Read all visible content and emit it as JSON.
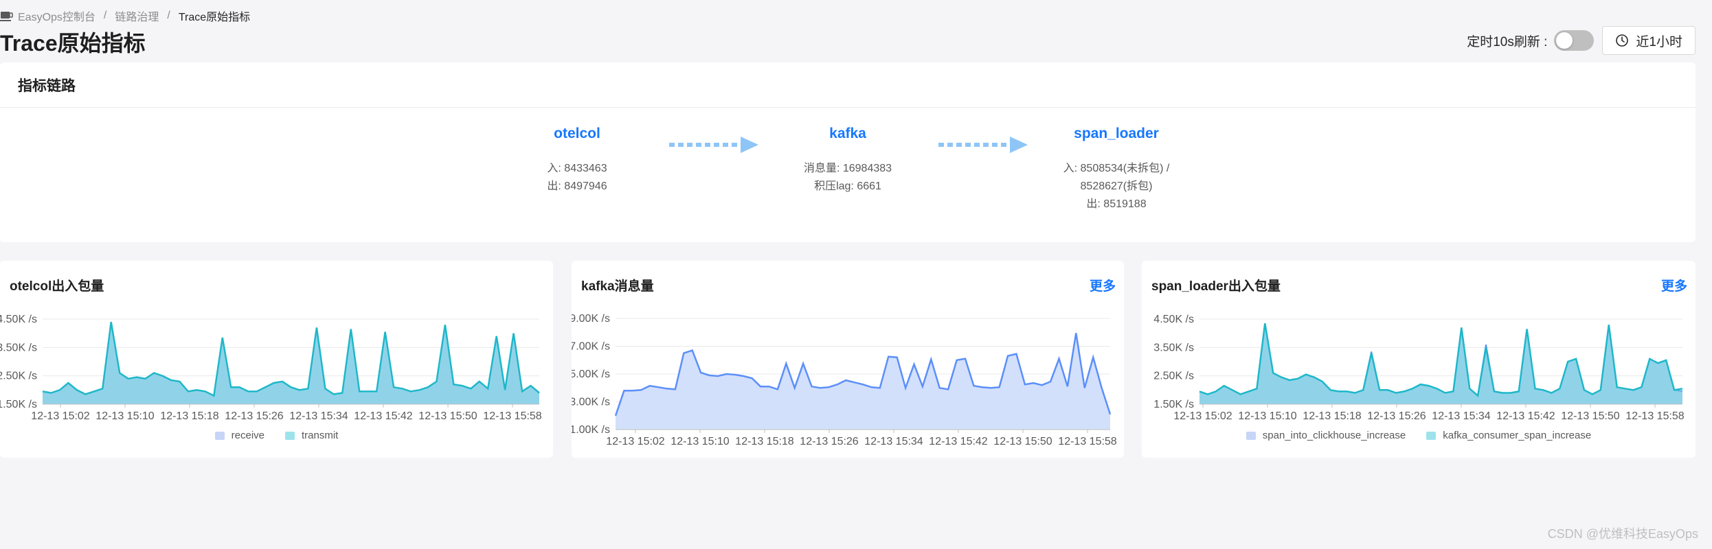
{
  "breadcrumb": {
    "items": [
      "EasyOps控制台",
      "链路治理",
      "Trace原始指标"
    ],
    "separator": "/"
  },
  "page_title": "Trace原始指标",
  "toolbar": {
    "refresh_label": "定时10s刷新 :",
    "refresh_enabled": false,
    "time_range": "近1小时"
  },
  "link_panel": {
    "title": "指标链路",
    "nodes": [
      {
        "name": "otelcol",
        "lines": [
          "入: 8433463",
          "出: 8497946"
        ]
      },
      {
        "name": "kafka",
        "lines": [
          "消息量: 16984383",
          "积压lag: 6661"
        ]
      },
      {
        "name": "span_loader",
        "lines": [
          "入: 8508534(未拆包) /",
          "8528627(拆包)",
          "出: 8519188"
        ]
      }
    ]
  },
  "cards": {
    "otelcol": {
      "title": "otelcol出入包量"
    },
    "kafka": {
      "title": "kafka消息量",
      "more": "更多"
    },
    "span_loader": {
      "title": "span_loader出入包量",
      "more": "更多"
    }
  },
  "colors": {
    "accent": "#1677ff",
    "receive_fill": "#c6d4f7",
    "transmit_line": "#1fb7c9",
    "kafka_line": "#5b8ff9",
    "kafka_fill": "#d3e0fb"
  },
  "watermark": "CSDN @优维科技EasyOps",
  "chart_data": [
    {
      "type": "area",
      "title": "otelcol出入包量",
      "x": [
        "12-13 15:02",
        "12-13 15:10",
        "12-13 15:18",
        "12-13 15:26",
        "12-13 15:34",
        "12-13 15:42",
        "12-13 15:50",
        "12-13 15:58"
      ],
      "y_ticks": [
        "1.50K /s",
        "2.50K /s",
        "3.50K /s",
        "4.50K /s"
      ],
      "ylim": [
        1500,
        4500
      ],
      "legend_position": "bottom",
      "series": [
        {
          "name": "receive",
          "color": "#c6d4f7",
          "values": [
            1950,
            1900,
            2000,
            2250,
            2000,
            1850,
            1950,
            2050,
            4400,
            2600,
            2400,
            2450,
            2400,
            2600,
            2500,
            2350,
            2300,
            1950,
            2000,
            1950,
            1800,
            3850,
            2100,
            2100,
            1950,
            1950,
            2100,
            2250,
            2300,
            2100,
            2000,
            2050,
            4200,
            2050,
            1850,
            1900,
            4150,
            1950,
            1950,
            1950,
            4050,
            2100,
            2050,
            1950,
            2000,
            2100,
            2300,
            4300,
            2200,
            2150,
            2050,
            2300,
            2050,
            3900,
            2000,
            4000,
            1950,
            2150,
            1900
          ]
        },
        {
          "name": "transmit",
          "color": "#1fb7c9",
          "values": [
            1950,
            1900,
            2000,
            2250,
            2000,
            1850,
            1950,
            2050,
            4400,
            2600,
            2400,
            2450,
            2400,
            2600,
            2500,
            2350,
            2300,
            1950,
            2000,
            1950,
            1800,
            3850,
            2100,
            2100,
            1950,
            1950,
            2100,
            2250,
            2300,
            2100,
            2000,
            2050,
            4200,
            2050,
            1850,
            1900,
            4150,
            1950,
            1950,
            1950,
            4050,
            2100,
            2050,
            1950,
            2000,
            2100,
            2300,
            4300,
            2200,
            2150,
            2050,
            2300,
            2050,
            3900,
            2000,
            4000,
            1950,
            2150,
            1900
          ]
        }
      ]
    },
    {
      "type": "area",
      "title": "kafka消息量",
      "x": [
        "12-13 15:02",
        "12-13 15:10",
        "12-13 15:18",
        "12-13 15:26",
        "12-13 15:34",
        "12-13 15:42",
        "12-13 15:50",
        "12-13 15:58"
      ],
      "y_ticks": [
        "1.00K /s",
        "3.00K /s",
        "5.00K /s",
        "7.00K /s",
        "9.00K /s"
      ],
      "ylim": [
        1000,
        9000
      ],
      "series": [
        {
          "name": "kafka消息量",
          "color": "#5b8ff9",
          "values": [
            2000,
            3800,
            3800,
            3850,
            4150,
            4050,
            3950,
            3900,
            6500,
            6700,
            5100,
            4900,
            4850,
            5000,
            4950,
            4850,
            4700,
            4100,
            4100,
            3900,
            5750,
            4000,
            5750,
            4100,
            4000,
            4050,
            4250,
            4550,
            4400,
            4250,
            4050,
            4000,
            6250,
            6200,
            4000,
            5700,
            4100,
            6050,
            4000,
            3900,
            6000,
            6100,
            4150,
            4050,
            4000,
            4050,
            6300,
            6450,
            4250,
            4350,
            4200,
            4450,
            6100,
            4100,
            7950,
            4000,
            6200,
            4000,
            2100
          ]
        }
      ]
    },
    {
      "type": "area",
      "title": "span_loader出入包量",
      "x": [
        "12-13 15:02",
        "12-13 15:10",
        "12-13 15:18",
        "12-13 15:26",
        "12-13 15:34",
        "12-13 15:42",
        "12-13 15:50",
        "12-13 15:58"
      ],
      "y_ticks": [
        "1.50K /s",
        "2.50K /s",
        "3.50K /s",
        "4.50K /s"
      ],
      "ylim": [
        1500,
        4500
      ],
      "legend_position": "bottom",
      "series": [
        {
          "name": "span_into_clickhouse_increase",
          "color": "#c6d4f7",
          "values": [
            1950,
            1850,
            1950,
            2150,
            2000,
            1850,
            1950,
            2050,
            4350,
            2600,
            2450,
            2350,
            2400,
            2550,
            2450,
            2300,
            2000,
            1950,
            1950,
            1900,
            2000,
            3350,
            2000,
            2000,
            1900,
            1950,
            2050,
            2200,
            2150,
            2050,
            1900,
            1950,
            4200,
            2050,
            1800,
            3600,
            1950,
            1900,
            1900,
            1950,
            4150,
            2050,
            2000,
            1900,
            2050,
            3000,
            3100,
            2000,
            1850,
            2000,
            4300,
            2100,
            2050,
            2000,
            2100,
            3100,
            2950,
            3050,
            2000,
            1950
          ]
        },
        {
          "name": "kafka_consumer_span_increase",
          "color": "#1fb7c9",
          "values": [
            1950,
            1850,
            1950,
            2150,
            2000,
            1850,
            1950,
            2050,
            4350,
            2600,
            2450,
            2350,
            2400,
            2550,
            2450,
            2300,
            2000,
            1950,
            1950,
            1900,
            2000,
            3300,
            2000,
            2000,
            1900,
            1950,
            2050,
            2200,
            2150,
            2050,
            1900,
            1950,
            4200,
            2050,
            1800,
            3500,
            1950,
            1900,
            1900,
            1950,
            4150,
            2050,
            2000,
            1900,
            2050,
            3000,
            3100,
            2000,
            1850,
            2000,
            4300,
            2100,
            2050,
            2000,
            2100,
            3100,
            2950,
            3050,
            2000,
            2050
          ]
        }
      ]
    }
  ]
}
